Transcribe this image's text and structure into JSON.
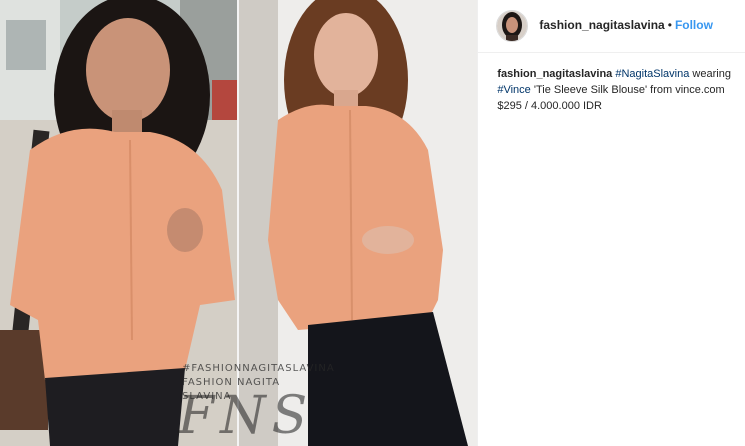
{
  "post": {
    "username": "fashion_nagitaslavina",
    "separator": "•",
    "follow_label": "Follow"
  },
  "caption": {
    "username": "fashion_nagitaslavina",
    "hashtag_1": "#NagitaSlavina",
    "text_1": " wearing",
    "hashtag_2": "#Vince",
    "text_2": " 'Tie Sleeve Silk Blouse' from vince.com",
    "price": "$295 / 4.000.000 IDR"
  },
  "watermark": {
    "text": "#FASHIONNAGITASLAVINA",
    "sub": "FASHION NAGITA SLAVINA",
    "mark": "FNS"
  },
  "colors": {
    "blouse": "#eaa27e",
    "follow": "#3897f0",
    "hashtag": "#003569"
  }
}
